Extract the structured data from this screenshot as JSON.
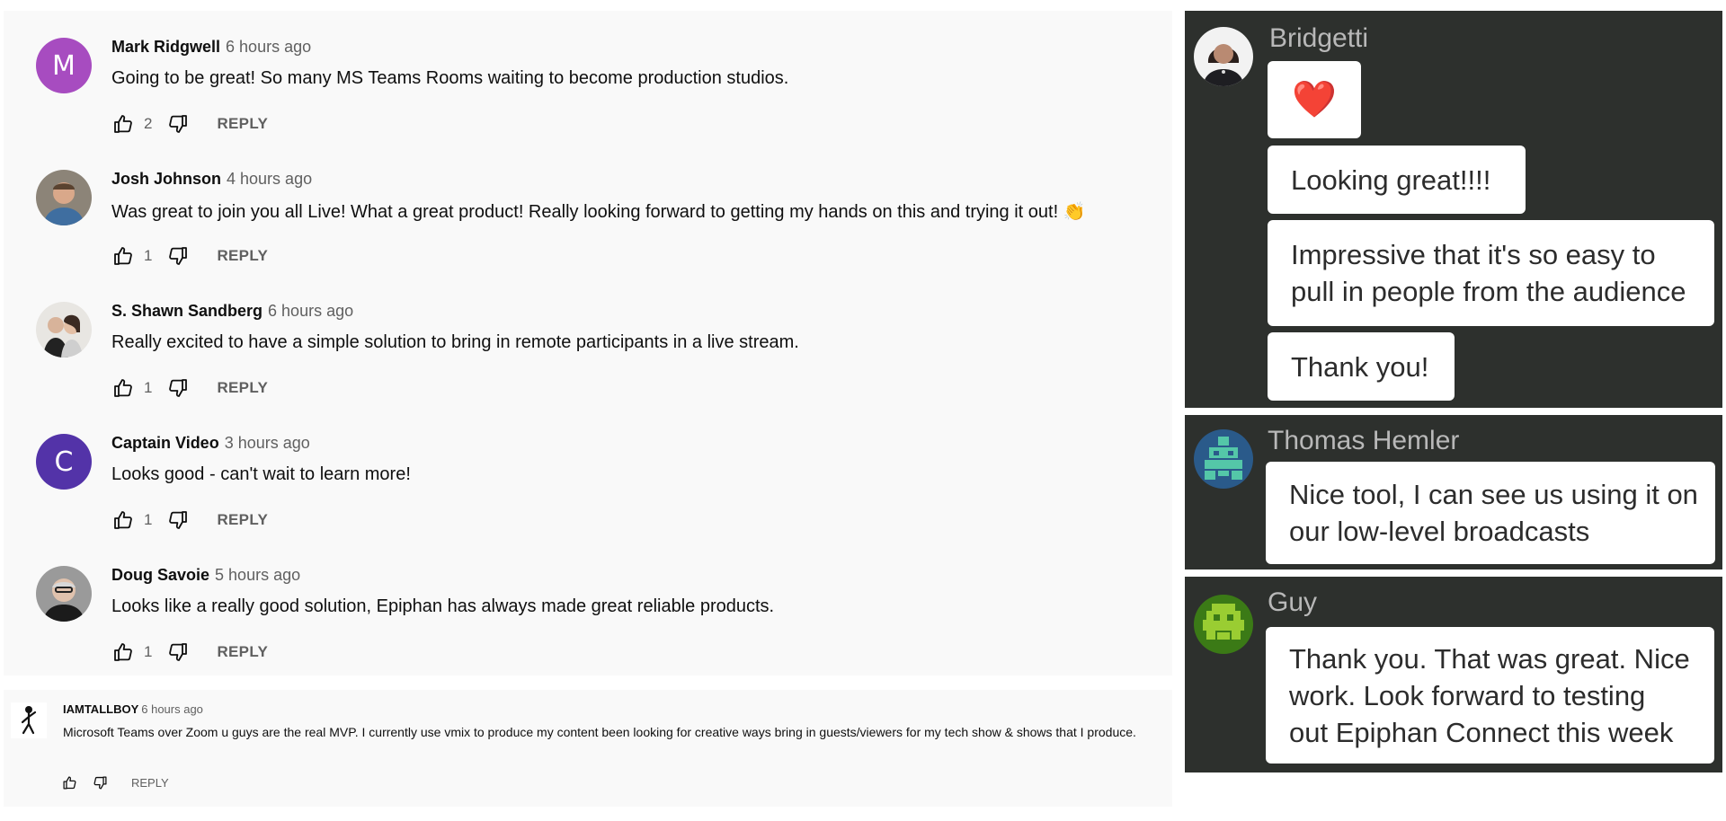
{
  "youtube_comments": [
    {
      "author": "Mark Ridgwell",
      "time": "6 hours ago",
      "text": "Going to be great! So many MS Teams Rooms waiting to become production studios.",
      "likes": "2",
      "reply_label": "REPLY",
      "avatar_letter": "M",
      "avatar_color": "#a74cc0"
    },
    {
      "author": "Josh Johnson",
      "time": "4 hours ago",
      "text": "Was great to join you all Live! What a great product! Really looking forward to getting my hands on this and trying it out! 👏",
      "likes": "1",
      "reply_label": "REPLY",
      "avatar_letter": "",
      "avatar_color": "#7a6f62"
    },
    {
      "author": "S. Shawn Sandberg",
      "time": "6 hours ago",
      "text": "Really excited to have a simple solution to bring in remote participants in a live stream.",
      "likes": "1",
      "reply_label": "REPLY",
      "avatar_letter": "",
      "avatar_color": "#5c5b63"
    },
    {
      "author": "Captain Video",
      "time": "3 hours ago",
      "text": "Looks good - can't wait to learn more!",
      "likes": "1",
      "reply_label": "REPLY",
      "avatar_letter": "C",
      "avatar_color": "#5333a8"
    },
    {
      "author": "Doug Savoie",
      "time": "5 hours ago",
      "text": "Looks like a really good solution, Epiphan has always made great reliable products.",
      "likes": "1",
      "reply_label": "REPLY",
      "avatar_letter": "",
      "avatar_color": "#8a8a8a"
    }
  ],
  "small_comment": {
    "author": "IAMTALLBOY",
    "time": "6 hours ago",
    "text": "Microsoft Teams over Zoom u guys are the real MVP.  I currently use vmix to produce my content been looking for creative ways bring in guests/viewers for my tech show & shows that I produce.",
    "reply_label": "REPLY"
  },
  "chat": {
    "bridgetti": {
      "name": "Bridgetti",
      "messages": [
        "❤️",
        "Looking great!!!!",
        "Impressive that it's so easy to\npull in people from the audience",
        "Thank you!"
      ]
    },
    "thomas": {
      "name": "Thomas Hemler",
      "message": "Nice tool, I can see us using it on\nour low-level broadcasts",
      "avatar_color": "#54c7a8"
    },
    "guy": {
      "name": "Guy",
      "message": "Thank you. That was great. Nice\nwork. Look forward to testing\nout Epiphan Connect this week",
      "avatar_color": "#9acd32"
    }
  }
}
